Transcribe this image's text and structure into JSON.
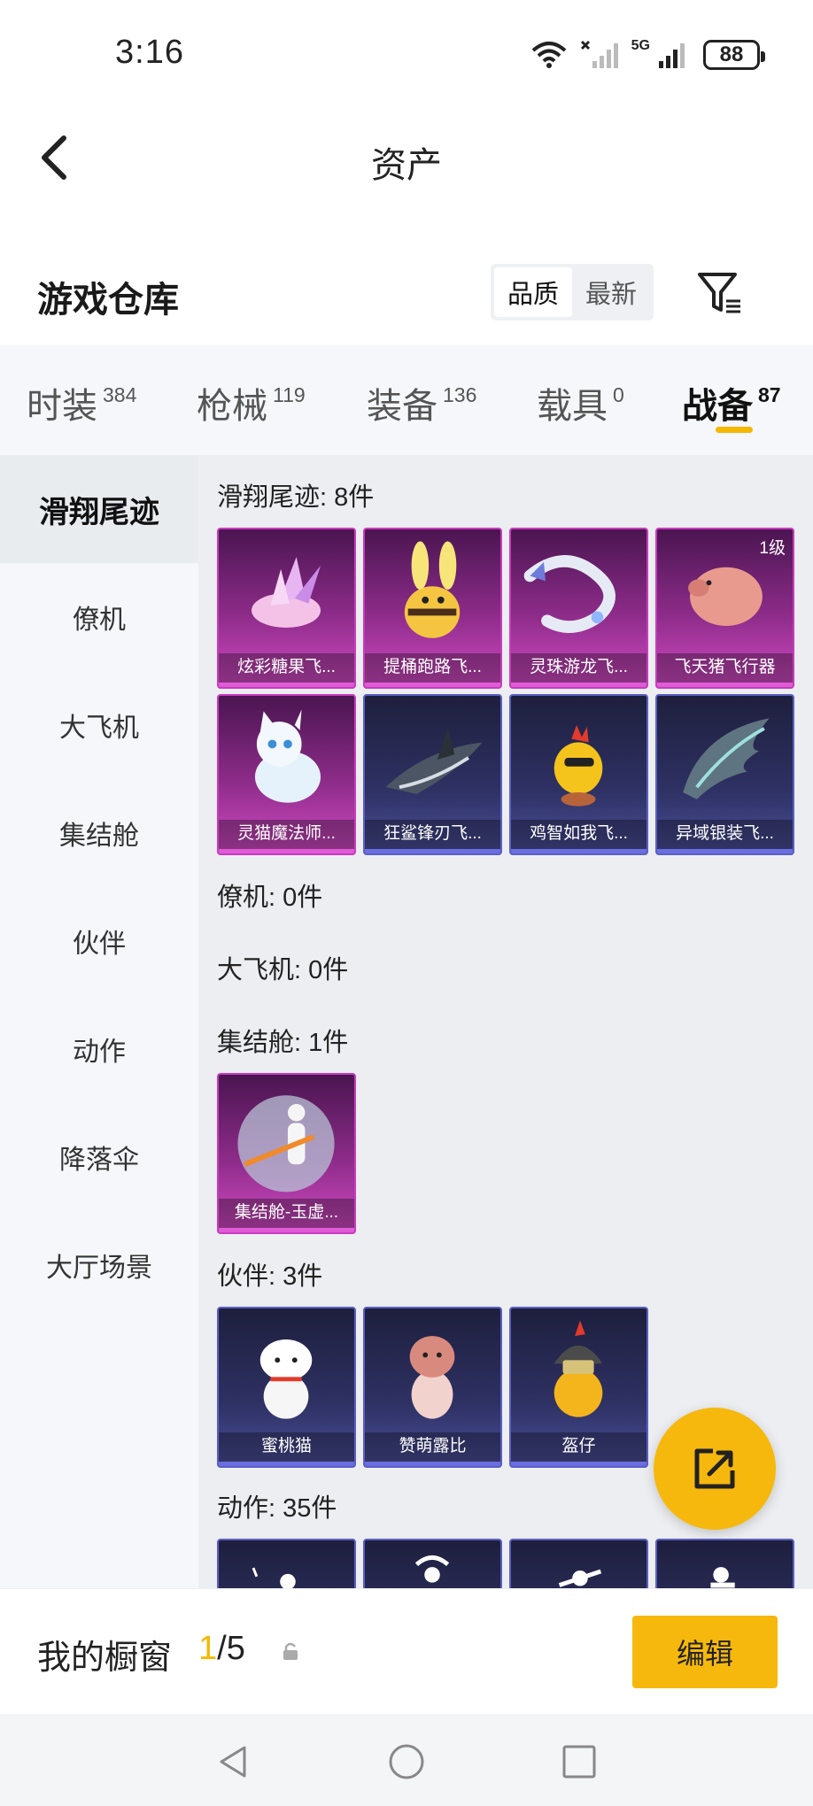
{
  "status": {
    "time": "3:16",
    "network": "5G",
    "battery": "88"
  },
  "header": {
    "title": "资产"
  },
  "warehouse": {
    "title": "游戏仓库",
    "sort_options": [
      "品质",
      "最新"
    ],
    "active_sort": "品质"
  },
  "tabs": [
    {
      "label": "时装",
      "count": "384"
    },
    {
      "label": "枪械",
      "count": "119"
    },
    {
      "label": "装备",
      "count": "136"
    },
    {
      "label": "载具",
      "count": "0"
    },
    {
      "label": "战备",
      "count": "87"
    }
  ],
  "sidebar": {
    "items": [
      "滑翔尾迹",
      "僚机",
      "大飞机",
      "集结舱",
      "伙伴",
      "动作",
      "降落伞",
      "大厅场景"
    ],
    "active": "滑翔尾迹"
  },
  "sections": [
    {
      "title": "滑翔尾迹: 8件"
    },
    {
      "title": "僚机: 0件"
    },
    {
      "title": "大飞机: 0件"
    },
    {
      "title": "集结舱: 1件"
    },
    {
      "title": "伙伴: 3件"
    },
    {
      "title": "动作: 35件"
    }
  ],
  "items": {
    "trails": [
      {
        "name": "炫彩糖果飞...",
        "rarity": "purple",
        "icon": "candy-icon"
      },
      {
        "name": "提桶跑路飞...",
        "rarity": "purple",
        "icon": "bee-icon"
      },
      {
        "name": "灵珠游龙飞...",
        "rarity": "purple",
        "icon": "dragon-icon"
      },
      {
        "name": "飞天猪飞行器",
        "rarity": "purple",
        "icon": "pig-icon",
        "badge": "1级"
      },
      {
        "name": "灵猫魔法师...",
        "rarity": "purple",
        "icon": "cat-icon"
      },
      {
        "name": "狂鲨锋刃飞...",
        "rarity": "blue",
        "icon": "shark-icon"
      },
      {
        "name": "鸡智如我飞...",
        "rarity": "blue",
        "icon": "chicken-icon"
      },
      {
        "name": "异域银装飞...",
        "rarity": "blue",
        "icon": "wing-icon"
      }
    ],
    "pods": [
      {
        "name": "集结舱-玉虚...",
        "rarity": "purple",
        "icon": "pod-icon"
      }
    ],
    "partners": [
      {
        "name": "蜜桃猫",
        "rarity": "blue",
        "icon": "peach-cat-icon"
      },
      {
        "name": "赞萌露比",
        "rarity": "blue",
        "icon": "beaver-icon"
      },
      {
        "name": "盔仔",
        "rarity": "blue",
        "icon": "helmet-chick-icon"
      }
    ]
  },
  "showcase": {
    "label": "我的橱窗",
    "current": "1",
    "total": "/5",
    "edit_label": "编辑"
  },
  "colors": {
    "accent": "#f6b80c",
    "purple_rarity": "#c93bbf",
    "blue_rarity": "#5b5fc4"
  }
}
